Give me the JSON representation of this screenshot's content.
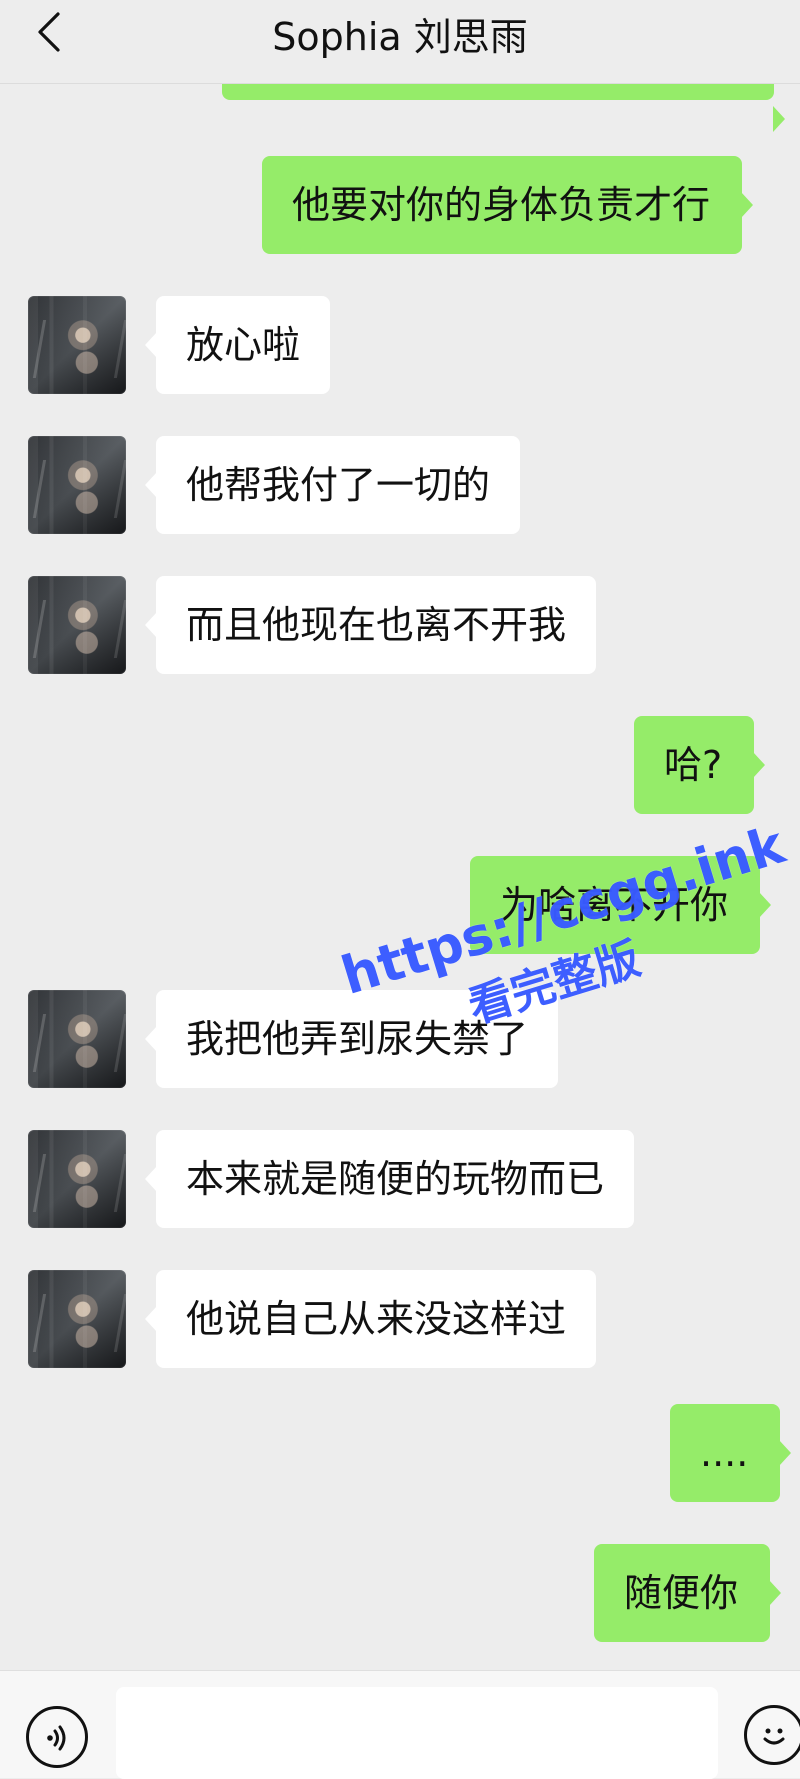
{
  "header": {
    "title": "Sophia 刘思雨"
  },
  "messages": [
    {
      "side": "sent",
      "text": "他要对你的身体负责才行"
    },
    {
      "side": "received",
      "text": "放心啦"
    },
    {
      "side": "received",
      "text": "他帮我付了一切的"
    },
    {
      "side": "received",
      "text": "而且他现在也离不开我"
    },
    {
      "side": "sent",
      "text": "哈?"
    },
    {
      "side": "sent",
      "text": "为啥离不开你"
    },
    {
      "side": "received",
      "text": "我把他弄到尿失禁了"
    },
    {
      "side": "received",
      "text": "本来就是随便的玩物而已"
    },
    {
      "side": "received",
      "text": "他说自己从来没这样过"
    },
    {
      "side": "sent",
      "text": "...."
    },
    {
      "side": "sent",
      "text": "随便你"
    }
  ],
  "watermark": {
    "url": "https://ccgg.ink",
    "text": "看完整版"
  },
  "input": {
    "placeholder": "",
    "value": ""
  },
  "icons": {
    "back": "back-arrow-icon",
    "voice": "voice-icon",
    "emoji": "emoji-icon"
  },
  "colors": {
    "sent_bubble": "#95ec69",
    "received_bubble": "#ffffff",
    "background": "#ededed",
    "watermark": "#2248ff"
  }
}
